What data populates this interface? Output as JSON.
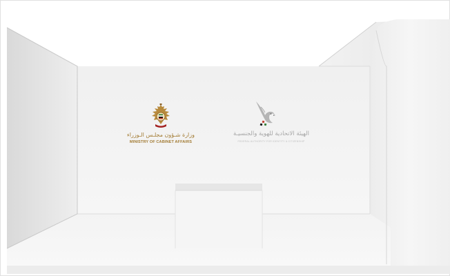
{
  "scene": {
    "type": "exhibition-booth-render"
  },
  "logos": {
    "moca": {
      "name_ar": "وزارة شـؤون مجلـس الـوزراء",
      "name_en": "MINISTRY OF CABINET AFFAIRS",
      "icon": "uae-federal-emblem-icon",
      "color": "#a27b33"
    },
    "ica": {
      "name_ar": "الهيئة الاتحادية للهوية والجنسيـة",
      "name_en": "FEDERAL AUTHORITY FOR IDENTITY & CITIZENSHIP",
      "icon": "falcon-logo-icon",
      "color": "#a7a7a7"
    }
  },
  "colors": {
    "wall": "#efefef",
    "side_wall": "#e3e3e3",
    "floor": "#f4f4f4",
    "counter": "#f2f2f2",
    "outline": "#d2d2d2"
  }
}
